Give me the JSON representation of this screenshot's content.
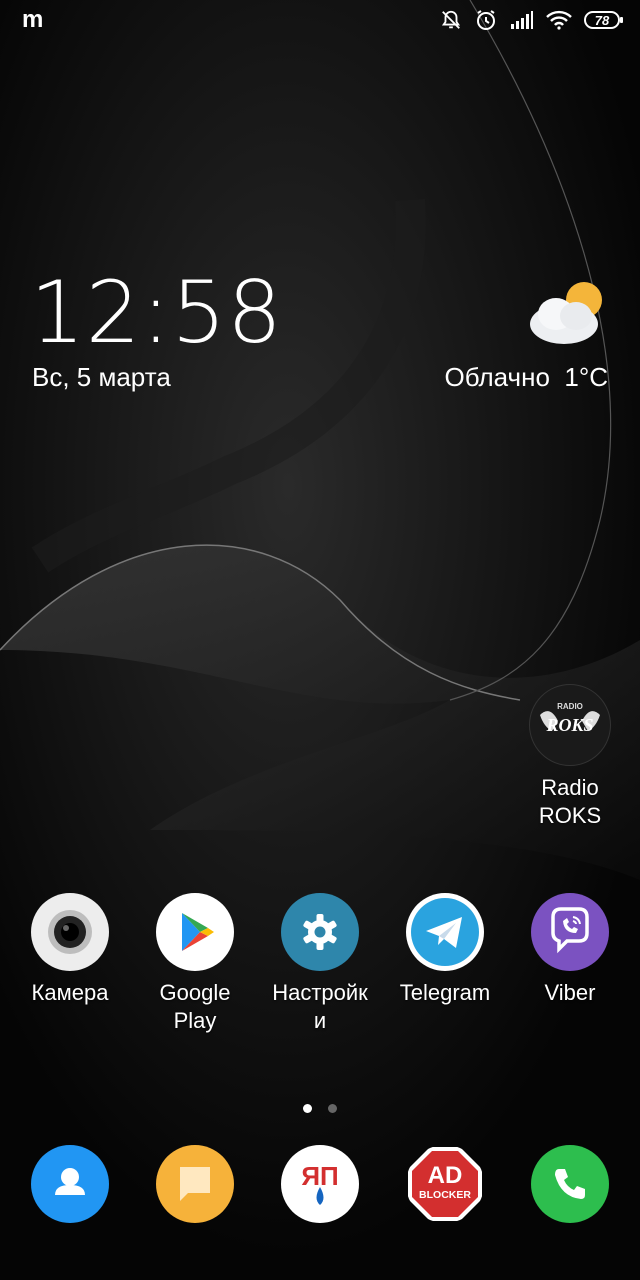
{
  "status_bar": {
    "carrier_mark": "m",
    "battery": "78"
  },
  "clock": {
    "time": "12:58",
    "date": "Вс, 5 марта"
  },
  "weather": {
    "condition": "Облачно",
    "temperature": "1°C",
    "icon": "partly-cloudy-icon"
  },
  "widget_apps": [
    {
      "label": "Radio\nROKS",
      "icon": "radio-roks-icon"
    }
  ],
  "home_apps": [
    {
      "label": "Камера",
      "icon": "camera-icon"
    },
    {
      "label": "Google Play",
      "icon": "google-play-icon"
    },
    {
      "label": "Настройк и",
      "icon": "settings-gear-icon"
    },
    {
      "label": "Telegram",
      "icon": "telegram-icon"
    },
    {
      "label": "Viber",
      "icon": "viber-icon"
    }
  ],
  "page_indicator": {
    "pages": 2,
    "current": 1
  },
  "dock": [
    {
      "name": "contacts",
      "icon": "contacts-icon",
      "color": "#2196F3"
    },
    {
      "name": "messages",
      "icon": "messages-icon",
      "color": "#F6B23A"
    },
    {
      "name": "yap",
      "icon": "yap-icon",
      "text": "ЯП",
      "color": "#ffffff"
    },
    {
      "name": "adblocker",
      "icon": "adblocker-icon",
      "text_top": "AD",
      "text_bottom": "BLOCKER",
      "color": "#D32F2F"
    },
    {
      "name": "phone",
      "icon": "phone-icon",
      "color": "#2DBE4E"
    }
  ]
}
